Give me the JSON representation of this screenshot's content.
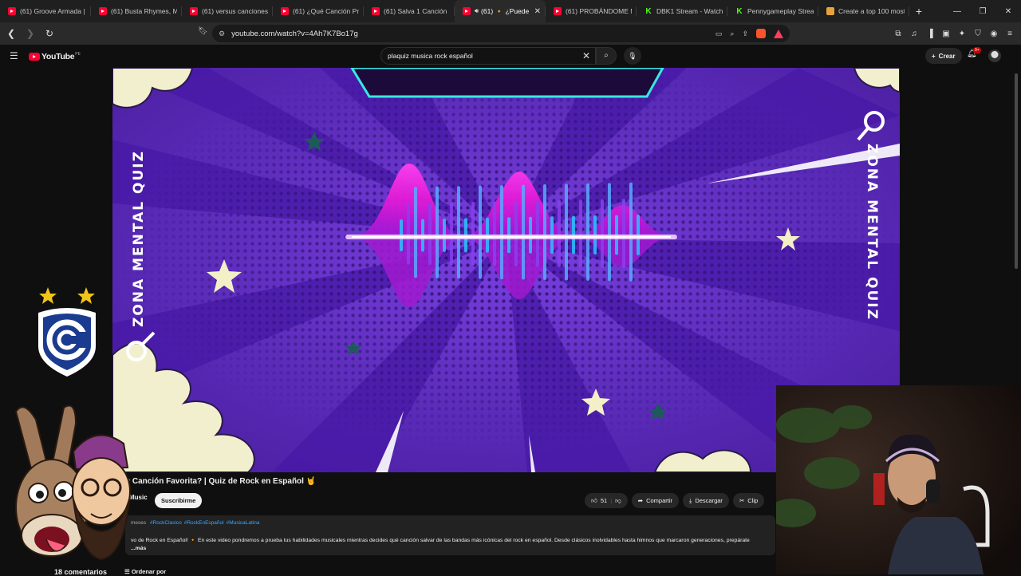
{
  "browser": {
    "tabs": [
      {
        "title": "(61) Groove Armada | E",
        "favicon": "youtube",
        "active": false
      },
      {
        "title": "(61) Busta Rhymes, Ma",
        "favicon": "youtube",
        "active": false
      },
      {
        "title": "(61) versus canciones p",
        "favicon": "youtube",
        "active": false
      },
      {
        "title": "(61) ¿Qué Canción Pre",
        "favicon": "youtube",
        "active": false
      },
      {
        "title": "(61) Salva 1 Canción 🔥",
        "favicon": "youtube",
        "active": false
      },
      {
        "title": "(61) 🔸 ¿Puede",
        "favicon": "youtube",
        "active": true
      },
      {
        "title": "(61) PROBÁNDOME M",
        "favicon": "youtube",
        "active": false
      },
      {
        "title": "DBK1 Stream - Watch",
        "favicon": "kick",
        "active": false
      },
      {
        "title": "Pennygameplay Strea",
        "favicon": "kick",
        "active": false
      },
      {
        "title": "Create a top 100 most",
        "favicon": "document",
        "active": false
      }
    ],
    "url": "youtube.com/watch?v=4Ah7K7Bo17g"
  },
  "youtube": {
    "logo_text": "YouTube",
    "country_code": "PE",
    "search_query": "plaquiz musica rock español",
    "create_label": "Crear",
    "notification_count": "9+"
  },
  "video": {
    "overlay_text_left": "ZONA MENTAL QUIZ",
    "overlay_text_right": "ZONA MENTAL QUIZ",
    "title": "u Canción Favorita? | Quiz de Rock en Español 🤘",
    "channel": "Music",
    "subscribe_label": "Suscribirme",
    "likes": "51",
    "share_label": "Compartir",
    "download_label": "Descargar",
    "clip_label": "Clip",
    "date_fragment": "meses",
    "hashtags": [
      "#RockClasico",
      "#RockEnEspañol",
      "#MusicaLatina"
    ],
    "description": "vo de Rock en Español! 🔸 En este video pondremos a prueba tus habilidades musicales mientras decides qué canción salvar de las bandas más icónicas del rock en español. Desde clásicos inolvidables hasta himnos que marcaron generaciones, prepárate",
    "more_label": "...más",
    "comments_count": "18 comentarios",
    "sort_label": "Ordenar por"
  },
  "colors": {
    "background": "#0f0f0f",
    "video_purple": "#5a2bb8",
    "magenta": "#ff19e6",
    "cyan": "#27c4ff",
    "youtube_red": "#ff0033"
  }
}
